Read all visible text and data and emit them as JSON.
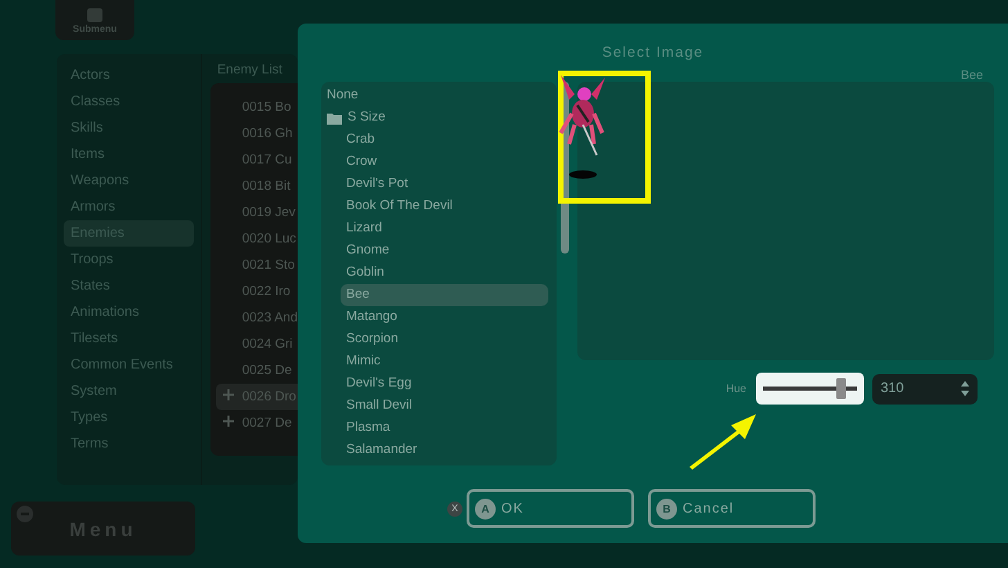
{
  "top_button": {
    "label": "Submenu"
  },
  "categories": [
    {
      "label": "Actors",
      "selected": false
    },
    {
      "label": "Classes",
      "selected": false
    },
    {
      "label": "Skills",
      "selected": false
    },
    {
      "label": "Items",
      "selected": false
    },
    {
      "label": "Weapons",
      "selected": false
    },
    {
      "label": "Armors",
      "selected": false
    },
    {
      "label": "Enemies",
      "selected": true
    },
    {
      "label": "Troops",
      "selected": false
    },
    {
      "label": "States",
      "selected": false
    },
    {
      "label": "Animations",
      "selected": false
    },
    {
      "label": "Tilesets",
      "selected": false
    },
    {
      "label": "Common Events",
      "selected": false
    },
    {
      "label": "System",
      "selected": false
    },
    {
      "label": "Types",
      "selected": false
    },
    {
      "label": "Terms",
      "selected": false
    }
  ],
  "enemy_list": {
    "title": "Enemy List",
    "items": [
      {
        "label": "0015 Bo",
        "expandable": false,
        "selected": false
      },
      {
        "label": "0016 Gh",
        "expandable": false,
        "selected": false
      },
      {
        "label": "0017 Cu",
        "expandable": false,
        "selected": false
      },
      {
        "label": "0018 Bit",
        "expandable": false,
        "selected": false
      },
      {
        "label": "0019 Jev",
        "expandable": false,
        "selected": false
      },
      {
        "label": "0020 Luc",
        "expandable": false,
        "selected": false
      },
      {
        "label": "0021 Sto",
        "expandable": false,
        "selected": false
      },
      {
        "label": "0022 Iro",
        "expandable": false,
        "selected": false
      },
      {
        "label": "0023 And",
        "expandable": false,
        "selected": false
      },
      {
        "label": "0024 Gri",
        "expandable": false,
        "selected": false
      },
      {
        "label": "0025 De",
        "expandable": false,
        "selected": false
      },
      {
        "label": "0026 Dro",
        "expandable": true,
        "selected": true
      },
      {
        "label": "0027 De",
        "expandable": true,
        "selected": false
      }
    ]
  },
  "menu_button": {
    "label": "Menu"
  },
  "dialog": {
    "title": "Select Image",
    "files": [
      {
        "label": "None",
        "kind": "item",
        "selected": false
      },
      {
        "label": "S Size",
        "kind": "folder",
        "selected": false,
        "children": [
          {
            "label": "Crab",
            "kind": "item",
            "selected": false
          },
          {
            "label": "Crow",
            "kind": "item",
            "selected": false
          },
          {
            "label": "Devil's Pot",
            "kind": "item",
            "selected": false
          },
          {
            "label": "Book Of The Devil",
            "kind": "item",
            "selected": false
          },
          {
            "label": "Lizard",
            "kind": "item",
            "selected": false
          },
          {
            "label": "Gnome",
            "kind": "item",
            "selected": false
          },
          {
            "label": "Goblin",
            "kind": "item",
            "selected": false
          },
          {
            "label": "Bee",
            "kind": "item",
            "selected": true
          },
          {
            "label": "Matango",
            "kind": "item",
            "selected": false
          },
          {
            "label": "Scorpion",
            "kind": "item",
            "selected": false
          },
          {
            "label": "Mimic",
            "kind": "item",
            "selected": false
          },
          {
            "label": "Devil's Egg",
            "kind": "item",
            "selected": false
          },
          {
            "label": "Small Devil",
            "kind": "item",
            "selected": false
          },
          {
            "label": "Plasma",
            "kind": "item",
            "selected": false
          },
          {
            "label": "Salamander",
            "kind": "item",
            "selected": false
          }
        ]
      }
    ],
    "preview_name": "Bee",
    "hue": {
      "label": "Hue",
      "level": 0.83,
      "value": "310"
    },
    "buttons": [
      {
        "key": "A",
        "label": "OK"
      },
      {
        "key": "B",
        "label": "Cancel"
      }
    ],
    "close_key": "X"
  }
}
